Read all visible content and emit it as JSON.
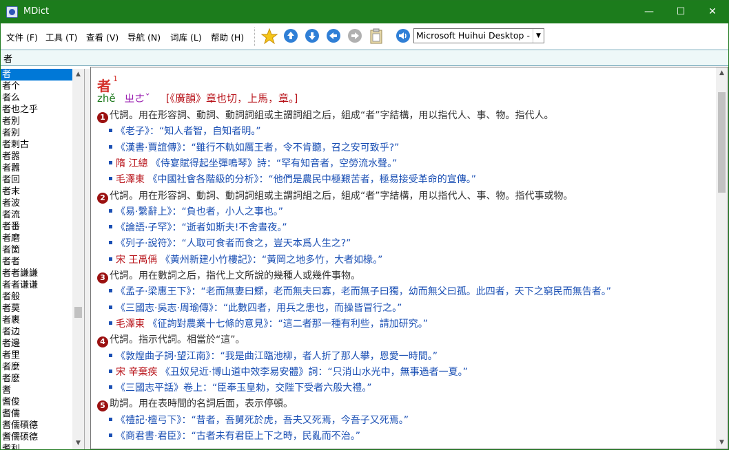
{
  "window": {
    "title": "MDict",
    "minimize": "—",
    "maximize": "☐",
    "close": "✕"
  },
  "menu": [
    "文件 (F)",
    "工具 (T)",
    "查看 (V)",
    "导航 (N)",
    "词库 (L)",
    "帮助 (H)"
  ],
  "toolbar": {
    "font_value": "Microsoft Huihui Desktop - C"
  },
  "search": {
    "value": "者"
  },
  "wordlist": [
    "者",
    "者个",
    "者么",
    "者也之乎",
    "者別",
    "者别",
    "者剌古",
    "者嚣",
    "者囂",
    "者回",
    "者末",
    "者波",
    "者流",
    "者番",
    "者磨",
    "者箇",
    "者者",
    "者者謙謙",
    "者者谦谦",
    "者般",
    "者莫",
    "者裹",
    "者边",
    "者邊",
    "者里",
    "者麼",
    "者麽",
    "耆",
    "耆俊",
    "耆儒",
    "耆儒碩德",
    "耆儒硕德",
    "耆利"
  ],
  "entry": {
    "headword": "者",
    "sup": "1",
    "pinyin": "zhě",
    "bopomofo": "ㄓㄜˇ",
    "rhyme": "[《廣韻》章也切，上馬，章。]",
    "senses": [
      {
        "n": "1",
        "text": "代詞。用在形容詞、動詞、動詞詞組或主謂詞組之后，組成“者”字結構，用以指代人、事、物。指代人。",
        "cites": [
          {
            "author": "",
            "book": "",
            "text": "《老子》：“知人者智，自知者明。”"
          },
          {
            "author": "",
            "book": "",
            "text": "《漢書·賈誼傳》：“雖行不軌如厲王者，令不肯聽，召之安可致乎?”"
          },
          {
            "author": "隋 江總",
            "book": "",
            "text": " 《侍宴賦得起坐彈鳴琴》詩：“罕有知音者，空勞流水聲。”"
          },
          {
            "author": "毛澤東",
            "book": "",
            "text": " 《中國社會各階級的分析》：“他們是農民中極艱苦者，極易接受革命的宣傳。”"
          }
        ]
      },
      {
        "n": "2",
        "text": "代詞。用在形容詞、動詞、動詞詞組或主謂詞組之后，組成“者”字結構，用以指代人、事、物。指代事或物。",
        "cites": [
          {
            "author": "",
            "book": "",
            "text": "《易·繫辭上》：“負也者，小人之事也。”"
          },
          {
            "author": "",
            "book": "",
            "text": "《論語·子罕》：“逝者如斯夫!不舍晝夜。”"
          },
          {
            "author": "",
            "book": "",
            "text": "《列子·說符》：“人取可食者而食之，豈天本爲人生之?”"
          },
          {
            "author": "宋 王禹偁",
            "book": "",
            "text": " 《黃州新建小竹樓記》：“黃岡之地多竹，大者如椽。”"
          }
        ]
      },
      {
        "n": "3",
        "text": "代詞。用在數詞之后，指代上文所說的幾種人或幾件事物。",
        "cites": [
          {
            "author": "",
            "book": "",
            "text": "《孟子·梁惠王下》：“老而無妻曰鰥，老而無夫曰寡，老而無子曰獨，幼而無父曰孤。此四者，天下之窮民而無告者。”"
          },
          {
            "author": "",
            "book": "",
            "text": "《三國志·吳志·周瑜傳》：“此數四者，用兵之患也，而操皆冒行之。”"
          },
          {
            "author": "毛澤東",
            "book": "",
            "text": " 《征詢對農業十七條的意見》：“這二者那一種有利些，請加研究。”"
          }
        ]
      },
      {
        "n": "4",
        "text": "代詞。指示代詞。相當於“這”。",
        "cites": [
          {
            "author": "",
            "book": "",
            "text": "《敦煌曲子詞·望江南》：“我是曲江臨池柳，者人折了那人攀，恩愛一時間。”"
          },
          {
            "author": "宋 辛棄疾",
            "book": "",
            "text": " 《丑奴兒近·博山道中效李易安體》詞：“只消山水光中，無事過者一夏。”"
          },
          {
            "author": "",
            "book": "",
            "text": "《三國志平話》卷上：“臣奉玉皇勑，交陛下受者六般大禮。”"
          }
        ]
      },
      {
        "n": "5",
        "text": "助詞。用在表時間的名詞后面，表示停頓。",
        "cites": [
          {
            "author": "",
            "book": "",
            "text": "《禮記·檀弓下》：“昔者，吾舅死於虎，吾夫又死焉，今吾子又死焉。”"
          },
          {
            "author": "",
            "book": "",
            "text": "《商君書·君臣》：“古者未有君臣上下之時，民亂而不治。”"
          }
        ]
      }
    ]
  },
  "colors": {
    "titlebar": "#1c7c1c",
    "headword": "#d4302a",
    "cite": "#1a4fb4",
    "author": "#b8131a",
    "num_badge": "#9b1111"
  }
}
